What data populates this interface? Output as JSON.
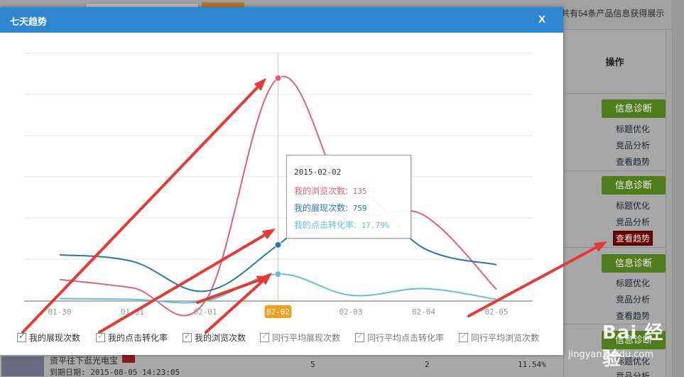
{
  "background": {
    "summary_text": "共有54条产品信息获得展示",
    "operations_header": "操作",
    "rows": [
      {
        "diagnose_label": "信息诊断",
        "links": [
          "标题优化",
          "竞品分析",
          "查看趋势"
        ]
      },
      {
        "diagnose_label": "信息诊断",
        "links": [
          "标题优化",
          "竞品分析",
          "查看趋势"
        ],
        "highlight_index": 2
      },
      {
        "diagnose_label": "信息诊断",
        "links": [
          "标题优化",
          "竞品分析",
          "查看趋势"
        ]
      },
      {
        "diagnose_label": "信息诊断",
        "links": [
          "标题优化",
          "竞品分析"
        ]
      }
    ],
    "bottom_row": {
      "title": "资平往下逛光电宝",
      "expire": "到期日期: 2015-08-05 14:23:05",
      "col_a": "5",
      "col_b": "2",
      "col_c": "11.54%"
    }
  },
  "modal": {
    "title": "七天趋势",
    "close_label": "X"
  },
  "chart_data": {
    "type": "line",
    "categories": [
      "01-30",
      "01-31",
      "02-01",
      "02-02",
      "02-03",
      "02-04",
      "02-05"
    ],
    "highlighted_category": "02-02",
    "ylim": [
      0,
      135
    ],
    "grid": "horizontal",
    "series": [
      {
        "name": "我的展现次数",
        "values": [
          28,
          24,
          6,
          34,
          68,
          32,
          22
        ],
        "color": "#2b77a6"
      },
      {
        "name": "我的点击转化率",
        "values": [
          1.5,
          1.0,
          0.0,
          16.3,
          3.5,
          7.5,
          1.0
        ],
        "color": "#63bfd8"
      },
      {
        "name": "我的浏览次数",
        "values": [
          13,
          8,
          0,
          135,
          58,
          52,
          7
        ],
        "color": "#e0607e"
      }
    ]
  },
  "tooltip": {
    "date": "2015-02-02",
    "views_label": "我的浏览次数:",
    "views_value": "135",
    "shows_label": "我的展现次数:",
    "shows_value": "759",
    "rate_label": "我的点击转化率:",
    "rate_value": "17.79%"
  },
  "legend": [
    {
      "label": "我的展现次数",
      "checked": true,
      "color": "#2b77a6"
    },
    {
      "label": "我的点击转化率",
      "checked": true,
      "color": "#63bfd8"
    },
    {
      "label": "我的浏览次数",
      "checked": true,
      "color": "#e0607e"
    },
    {
      "label": "同行平均展现次数",
      "checked": false,
      "color": "#aaaaaa"
    },
    {
      "label": "同行平均点击转化率",
      "checked": false,
      "color": "#aaaaaa"
    },
    {
      "label": "同行平均浏览次数",
      "checked": false,
      "color": "#aaaaaa"
    }
  ],
  "annotation_color": "#e53935",
  "watermark": {
    "logo_text": "Bai 经验",
    "url": "jingyan.baidu.com"
  }
}
